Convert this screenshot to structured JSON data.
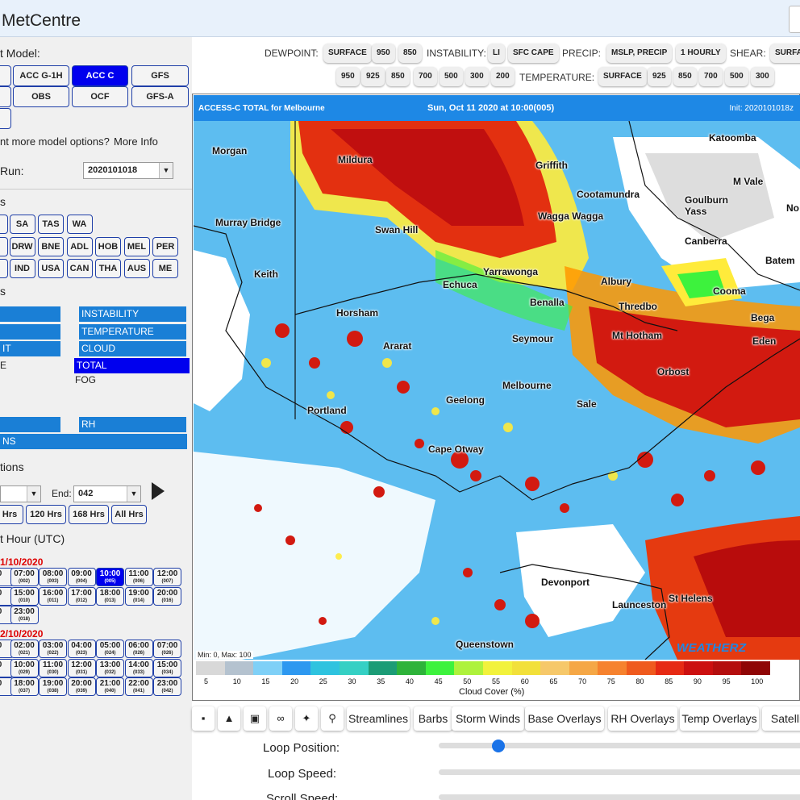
{
  "header": {
    "title": "MetCentre"
  },
  "sidebar": {
    "model_heading": "t Model:",
    "models": [
      "",
      "ACC G-1H",
      "ACC C",
      "GFS",
      "",
      "OBS",
      "OCF",
      "GFS-A",
      ""
    ],
    "model_active": "ACC C",
    "more_options": "nt more model options?",
    "more_info": "More Info",
    "run_label": "Run:",
    "run_value": "2020101018",
    "regions_heading": "s",
    "regions_row1": [
      "O",
      "SA",
      "TAS",
      "WA"
    ],
    "regions_row2": [
      "O",
      "DRW",
      "BNE",
      "ADL",
      "HOB",
      "MEL",
      "PER"
    ],
    "regions_row3": [
      "L",
      "IND",
      "USA",
      "CAN",
      "THA",
      "AUS",
      "ME"
    ],
    "params_heading": "s",
    "params": {
      "instability": "INSTABILITY",
      "temperature": "TEMPERATURE",
      "cloud": "CLOUD",
      "total": "TOTAL",
      "fog": "FOG",
      "rh": "RH",
      "left_it": "IT",
      "left_e": "E",
      "left_ns": "NS"
    },
    "loop_heading": "tions",
    "end_label": "End:",
    "end_value": "042",
    "ranges": [
      "2 Hrs",
      "120 Hrs",
      "168 Hrs",
      "All Hrs"
    ],
    "start_hour_heading": "t Hour (UTC)",
    "day1": "1/10/2020",
    "day1_times": [
      {
        "t": "0",
        "s": ""
      },
      {
        "t": "07:00",
        "s": "(002)"
      },
      {
        "t": "08:00",
        "s": "(003)"
      },
      {
        "t": "09:00",
        "s": "(004)"
      },
      {
        "t": "10:00",
        "s": "(005)"
      },
      {
        "t": "11:00",
        "s": "(006)"
      },
      {
        "t": "12:00",
        "s": "(007)"
      },
      {
        "t": "0",
        "s": ""
      },
      {
        "t": "15:00",
        "s": "(010)"
      },
      {
        "t": "16:00",
        "s": "(011)"
      },
      {
        "t": "17:00",
        "s": "(012)"
      },
      {
        "t": "18:00",
        "s": "(013)"
      },
      {
        "t": "19:00",
        "s": "(014)"
      },
      {
        "t": "20:00",
        "s": "(016)"
      },
      {
        "t": "0",
        "s": ""
      },
      {
        "t": "23:00",
        "s": "(018)"
      }
    ],
    "day1_active": "10:00",
    "day2": "2/10/2020",
    "day2_times": [
      {
        "t": "0",
        "s": ""
      },
      {
        "t": "02:00",
        "s": "(021)"
      },
      {
        "t": "03:00",
        "s": "(022)"
      },
      {
        "t": "04:00",
        "s": "(023)"
      },
      {
        "t": "05:00",
        "s": "(024)"
      },
      {
        "t": "06:00",
        "s": "(026)"
      },
      {
        "t": "07:00",
        "s": "(026)"
      },
      {
        "t": "0",
        "s": ""
      },
      {
        "t": "10:00",
        "s": "(029)"
      },
      {
        "t": "11:00",
        "s": "(030)"
      },
      {
        "t": "12:00",
        "s": "(031)"
      },
      {
        "t": "13:00",
        "s": "(032)"
      },
      {
        "t": "14:00",
        "s": "(033)"
      },
      {
        "t": "15:00",
        "s": "(034)"
      },
      {
        "t": "0",
        "s": ""
      },
      {
        "t": "18:00",
        "s": "(037)"
      },
      {
        "t": "19:00",
        "s": "(038)"
      },
      {
        "t": "20:00",
        "s": "(039)"
      },
      {
        "t": "21:00",
        "s": "(040)"
      },
      {
        "t": "22:00",
        "s": "(041)"
      },
      {
        "t": "23:00",
        "s": "(042)"
      }
    ]
  },
  "topbar": {
    "dewpoint_label": "DEWPOINT:",
    "dewpoint": [
      "SURFACE",
      "950",
      "850"
    ],
    "instability_label": "INSTABILITY:",
    "instability": [
      "LI",
      "SFC CAPE"
    ],
    "precip_label": "PRECIP:",
    "precip": [
      "MSLP, PRECIP",
      "1 HOURLY"
    ],
    "shear_label": "SHEAR:",
    "shear": [
      "SURFA"
    ],
    "row2_left": [
      "950",
      "925",
      "850",
      "700",
      "500",
      "300",
      "200"
    ],
    "temperature_label": "TEMPERATURE:",
    "temperature": [
      "SURFACE",
      "925",
      "850",
      "700",
      "500",
      "300"
    ]
  },
  "map": {
    "title_left": "ACCESS-C TOTAL for Melbourne",
    "title_center": "Sun, Oct 11 2020 at 10:00(005)",
    "title_right": "Init: 2020101018z",
    "minmax": "Min: 0, Max: 100",
    "logo": "WEATHERZ",
    "towns": [
      "Morgan",
      "Mildura",
      "Griffith",
      "Katoomba",
      "Cootamundra",
      "M Vale",
      "Goulburn",
      "Yass",
      "No",
      "Wagga Wagga",
      "Murray Bridge",
      "Swan Hill",
      "Canberra",
      "Batem",
      "Keith",
      "Yarrawonga",
      "Echuca",
      "Albury",
      "Cooma",
      "Benalla",
      "Horsham",
      "Thredbo",
      "Bega",
      "Seymour",
      "Mt Hotham",
      "Eden",
      "Ararat",
      "Orbost",
      "Melbourne",
      "Geelong",
      "Sale",
      "Portland",
      "Cape Otway",
      "Devonport",
      "St Helens",
      "Launceston",
      "Queenstown"
    ],
    "legend_ticks": [
      "5",
      "10",
      "15",
      "20",
      "25",
      "30",
      "35",
      "40",
      "45",
      "50",
      "55",
      "60",
      "65",
      "70",
      "75",
      "80",
      "85",
      "90",
      "95",
      "100"
    ],
    "legend_title": "Cloud Cover (%)",
    "legend_colors": [
      "#d8d8d8",
      "#b4c2cf",
      "#7fd0f7",
      "#2d98f0",
      "#2ec3df",
      "#35d0c4",
      "#1c9c76",
      "#2eb33a",
      "#3df23d",
      "#aef23c",
      "#f2f23c",
      "#f2e03a",
      "#f6c86a",
      "#f5a746",
      "#f6822e",
      "#ef5a1e",
      "#e62a14",
      "#cc1010",
      "#b40e0e",
      "#8f0606"
    ]
  },
  "toolbar": {
    "text_buttons": [
      "Streamlines",
      "Barbs",
      "Storm Winds",
      "Base Overlays",
      "RH Overlays",
      "Temp Overlays",
      "Satelli"
    ],
    "icons": [
      "save-icon",
      "road-icon",
      "train-icon",
      "link-icon",
      "satellite-icon",
      "search-icon"
    ]
  },
  "controls": {
    "loop_position": "Loop Position:",
    "loop_speed": "Loop Speed:",
    "scroll_speed": "Scroll Speed:",
    "loop_position_value": 0.16
  }
}
